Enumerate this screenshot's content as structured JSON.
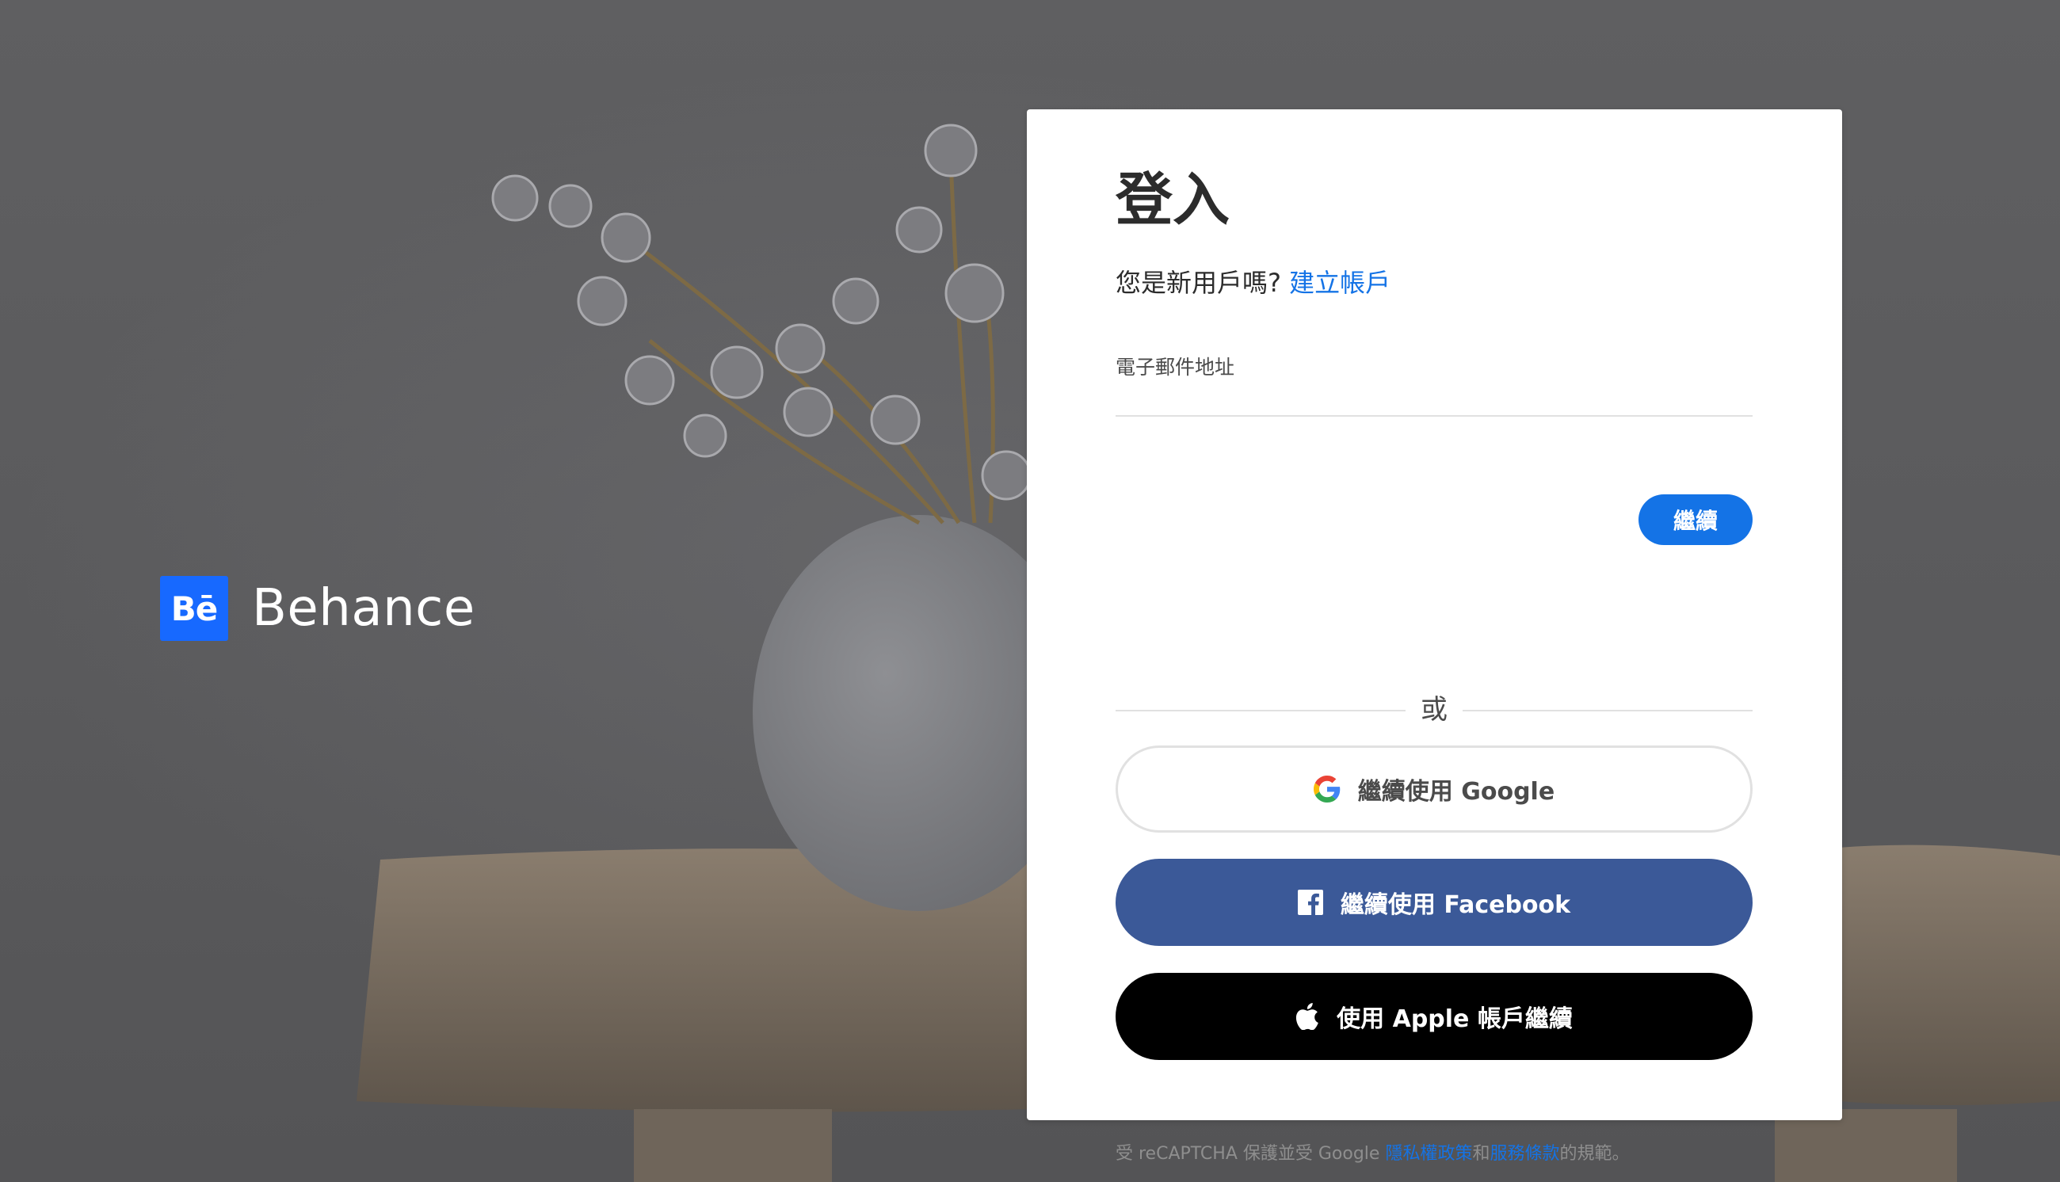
{
  "brand": {
    "logo_text": "Bē",
    "name": "Behance",
    "color": "#1769ff"
  },
  "signin": {
    "title": "登入",
    "new_user_prompt": "您是新用戶嗎?",
    "create_account_link": "建立帳戶",
    "email_label": "電子郵件地址",
    "email_value": "",
    "continue_label": "繼續",
    "or_text": "或"
  },
  "social": {
    "google_label": "繼續使用 Google",
    "google_icon": "google-g-icon",
    "facebook_label": "繼續使用 Facebook",
    "facebook_icon": "facebook-f-icon",
    "facebook_color": "#3b5998",
    "apple_label": "使用 Apple 帳戶繼續",
    "apple_icon": "apple-icon",
    "apple_color": "#000000"
  },
  "recaptcha": {
    "prefix": "受 reCAPTCHA 保護並受 Google ",
    "privacy_link": "隱私權政策",
    "and_text": "和",
    "terms_link": "服務條款",
    "suffix": "的規範。"
  },
  "colors": {
    "accent": "#1473e6",
    "text": "#2c2c2c"
  }
}
